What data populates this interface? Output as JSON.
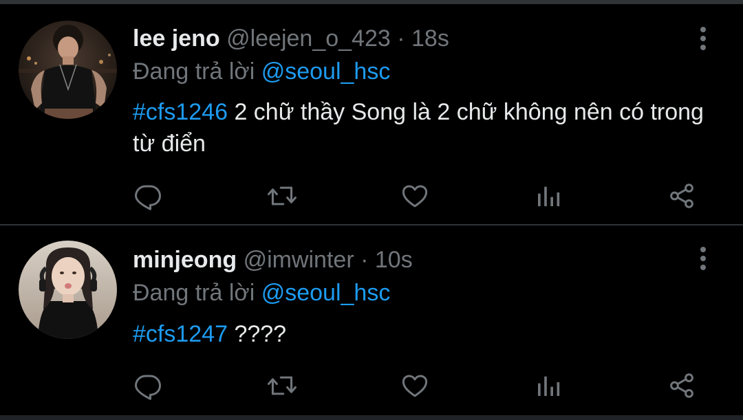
{
  "colors": {
    "background": "#000000",
    "divider": "#2f3336",
    "text_primary": "#e7e9ea",
    "text_secondary": "#71767b",
    "accent": "#1d9bf0"
  },
  "tweets": [
    {
      "display_name": "lee jeno",
      "handle": "@leejen_o_423",
      "separator": "·",
      "time": "18s",
      "reply_prefix": "Đang trả lời",
      "reply_to": "@seoul_hsc",
      "hashtag": "#cfs1246",
      "text": " 2 chữ thầy Song là 2 chữ không nên có trong từ điển",
      "avatar_icon": "user-avatar-photo",
      "actions": [
        "reply-icon",
        "retweet-icon",
        "like-icon",
        "views-icon",
        "share-icon"
      ]
    },
    {
      "display_name": "minjeong",
      "handle": "@imwinter",
      "separator": "·",
      "time": "10s",
      "reply_prefix": "Đang trả lời",
      "reply_to": "@seoul_hsc",
      "hashtag": "#cfs1247",
      "text": " ????",
      "avatar_icon": "user-avatar-photo",
      "actions": [
        "reply-icon",
        "retweet-icon",
        "like-icon",
        "views-icon",
        "share-icon"
      ]
    }
  ]
}
